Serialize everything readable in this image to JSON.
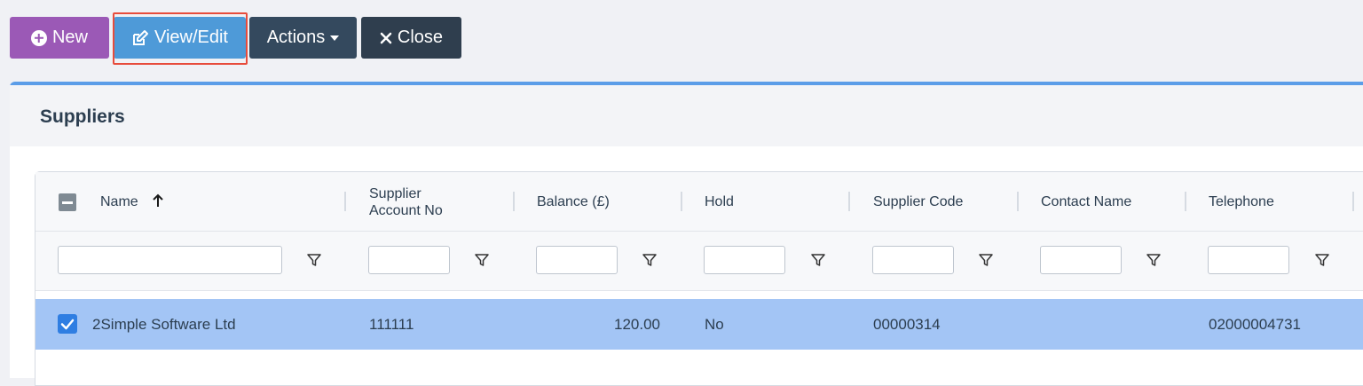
{
  "toolbar": {
    "new_label": "New",
    "view_edit_label": "View/Edit",
    "actions_label": "Actions",
    "close_label": "Close"
  },
  "panel": {
    "title": "Suppliers"
  },
  "grid": {
    "columns": [
      {
        "label": "Name",
        "sorted": "ascending"
      },
      {
        "label": "Supplier Account No"
      },
      {
        "label": "Balance (£)"
      },
      {
        "label": "Hold"
      },
      {
        "label": "Supplier Code"
      },
      {
        "label": "Contact Name"
      },
      {
        "label": "Telephone"
      }
    ],
    "filters": [
      "",
      "",
      "",
      "",
      "",
      "",
      ""
    ],
    "rows": [
      {
        "selected": true,
        "name": "2Simple Software Ltd",
        "account_no": "111111",
        "balance": "120.00",
        "hold": "No",
        "supplier_code": "00000314",
        "contact_name": "",
        "telephone": "02000004731"
      }
    ]
  },
  "colors": {
    "new": "#9b59b6",
    "view_edit": "#4e9ad8",
    "actions": "#34495e",
    "close": "#2f3e4e",
    "selected_row": "#a3c5f5",
    "highlight_border": "#e74c3c",
    "panel_accent": "#5b9de8"
  },
  "icons": [
    "plus-circle-icon",
    "edit-icon",
    "caret-down-icon",
    "close-icon",
    "sort-up-icon",
    "filter-icon",
    "checkbox-checked-icon",
    "checkbox-indeterminate-icon"
  ]
}
